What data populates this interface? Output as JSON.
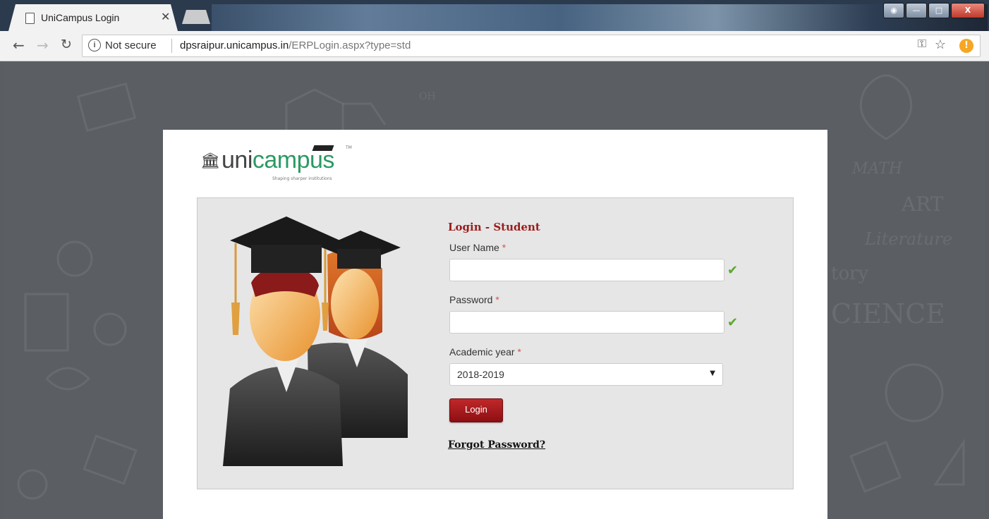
{
  "browser": {
    "tab_title": "UniCampus Login",
    "tab_close": "✕",
    "security_text": "Not secure",
    "url_host": "dpsraipur.unicampus.in",
    "url_path": "/ERPLogin.aspx?type=std",
    "icons": [
      "page-icon",
      "back-icon",
      "forward-icon",
      "reload-icon",
      "info-icon",
      "key-icon",
      "star-icon",
      "alert-icon"
    ]
  },
  "logo": {
    "text_part1": "uni",
    "text_part2": "campus",
    "tagline": "Shaping sharper institutions",
    "tm": "TM"
  },
  "form": {
    "heading": "Login - Student",
    "username_label": "User Name",
    "password_label": "Password",
    "year_label": "Academic year",
    "required_mark": "*",
    "username_value": "",
    "password_value": "",
    "year_value": "2018-2019",
    "login_label": "Login",
    "forgot_label": "Forgot Password?"
  },
  "background_words": [
    "MATH",
    "ART",
    "Literature",
    "tory",
    "CIENCE",
    "OH"
  ],
  "colors": {
    "accent": "#9b1c1c",
    "button": "#a8191c",
    "brand_green": "#2b9a63",
    "check": "#5aa82d"
  }
}
